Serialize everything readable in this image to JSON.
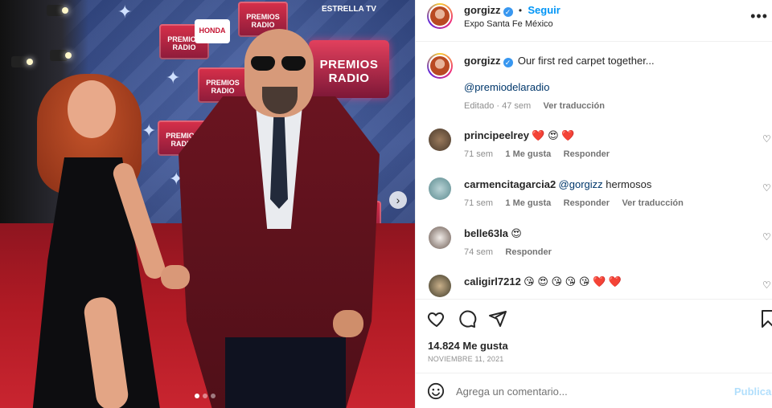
{
  "post": {
    "author": "gorgizz",
    "follow_label": "Seguir",
    "separator": "•",
    "location": "Expo Santa Fe México",
    "caption": "Our first red carpet together...",
    "mention": "@premiodelaradio",
    "edited_label": "Editado · 47 sem",
    "translate_label": "Ver traducción",
    "likes": "14.824 Me gusta",
    "date": "NOVIEMBRE 11, 2021"
  },
  "media": {
    "backdrop_brand": "ESTRELLA TV",
    "backdrop_logo": "PREMIOS RADIO",
    "sponsor": "HONDA",
    "slide_count": 3,
    "active_slide": 1
  },
  "comments": [
    {
      "user": "principeelrey",
      "text": "❤️ 😍 ❤️",
      "age": "71 sem",
      "likes": "1 Me gusta",
      "reply": "Responder",
      "translate": ""
    },
    {
      "user": "carmencitagarcia2",
      "mention": "@gorgizz",
      "text": " hermosos",
      "age": "71 sem",
      "likes": "1 Me gusta",
      "reply": "Responder",
      "translate": "Ver traducción"
    },
    {
      "user": "belle63la",
      "text": "😍",
      "age": "74 sem",
      "likes": "",
      "reply": "Responder",
      "translate": ""
    },
    {
      "user": "caligirl7212",
      "text": "😘 😍 😘 😘 😘 ❤️ ❤️",
      "age": "",
      "likes": "",
      "reply": "",
      "translate": ""
    }
  ],
  "composer": {
    "placeholder": "Agrega un comentario...",
    "publish_label": "Publicar"
  },
  "colors": {
    "accent": "#0095f6",
    "verified": "#3897f0",
    "carpet": "#b01a24",
    "jacket": "#6a1420"
  },
  "icons": [
    "verified-icon",
    "more-options-icon",
    "heart-icon",
    "comment-icon",
    "share-icon",
    "bookmark-icon",
    "emoji-icon",
    "next-slide-icon"
  ]
}
